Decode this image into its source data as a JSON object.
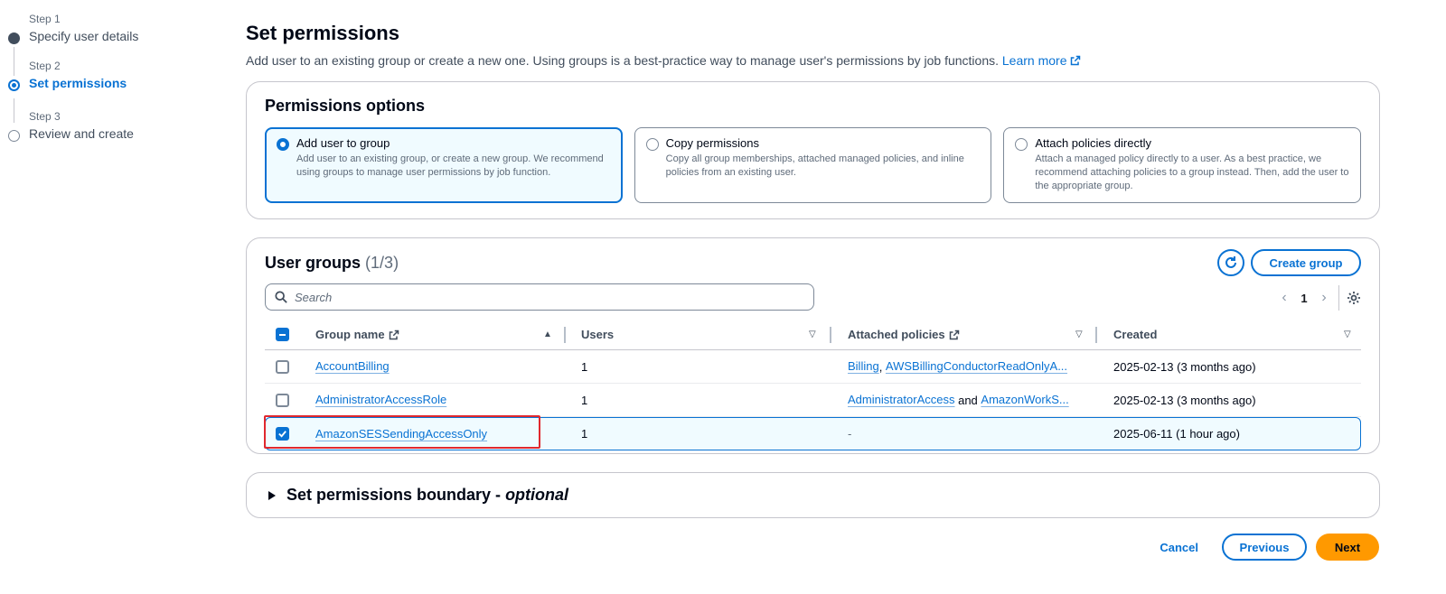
{
  "stepper": {
    "steps": [
      {
        "num": "Step 1",
        "title": "Specify user details",
        "state": "completed"
      },
      {
        "num": "Step 2",
        "title": "Set permissions",
        "state": "active"
      },
      {
        "num": "Step 3",
        "title": "Review and create",
        "state": "pending"
      }
    ]
  },
  "page": {
    "title": "Set permissions",
    "description": "Add user to an existing group or create a new one. Using groups is a best-practice way to manage user's permissions by job functions.",
    "learn_more": "Learn more"
  },
  "permissions_options": {
    "title": "Permissions options",
    "options": [
      {
        "title": "Add user to group",
        "desc": "Add user to an existing group, or create a new group. We recommend using groups to manage user permissions by job function.",
        "selected": true
      },
      {
        "title": "Copy permissions",
        "desc": "Copy all group memberships, attached managed policies, and inline policies from an existing user.",
        "selected": false
      },
      {
        "title": "Attach policies directly",
        "desc": "Attach a managed policy directly to a user. As a best practice, we recommend attaching policies to a group instead. Then, add the user to the appropriate group.",
        "selected": false
      }
    ]
  },
  "user_groups": {
    "title": "User groups",
    "count": "(1/3)",
    "create_label": "Create group",
    "search_placeholder": "Search",
    "page_number": "1",
    "columns": {
      "name": "Group name",
      "users": "Users",
      "policies": "Attached policies",
      "created": "Created"
    },
    "rows": [
      {
        "name": "AccountBilling",
        "users": "1",
        "policy_a": "Billing",
        "policy_joiner": ", ",
        "policy_b": "AWSBillingConductorReadOnlyA...",
        "created": "2025-02-13 (3 months ago)",
        "checked": false
      },
      {
        "name": "AdministratorAccessRole",
        "users": "1",
        "policy_a": "AdministratorAccess",
        "policy_joiner": " and ",
        "policy_b": "AmazonWorkS...",
        "created": "2025-02-13 (3 months ago)",
        "checked": false
      },
      {
        "name": "AmazonSESSendingAccessOnly",
        "users": "1",
        "policy_a": "-",
        "policy_joiner": "",
        "policy_b": "",
        "created": "2025-06-11 (1 hour ago)",
        "checked": true
      }
    ]
  },
  "boundary": {
    "title": "Set permissions boundary - ",
    "optional": "optional"
  },
  "footer": {
    "cancel": "Cancel",
    "previous": "Previous",
    "next": "Next"
  },
  "icons": {
    "external": "external-link-icon",
    "refresh": "refresh-icon",
    "search": "search-icon",
    "settings": "gear-icon"
  },
  "colors": {
    "accent": "#0972d3",
    "primary_button": "#ff9900",
    "highlight": "#e0282e"
  }
}
